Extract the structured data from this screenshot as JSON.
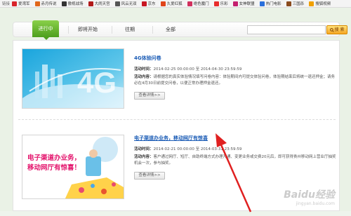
{
  "topbar": {
    "lead": "链接",
    "links": [
      {
        "label": "爱湾军",
        "color": "#d8232a"
      },
      {
        "label": "赤月传说",
        "color": "#e0671a"
      },
      {
        "label": "傲视战场",
        "color": "#333333"
      },
      {
        "label": "大闹天宫",
        "color": "#b11a1a"
      },
      {
        "label": "风云无双",
        "color": "#555555"
      },
      {
        "label": "京东",
        "color": "#c81623"
      },
      {
        "label": "久爱红狐",
        "color": "#e0441a"
      },
      {
        "label": "绝色魔门",
        "color": "#d1305d"
      },
      {
        "label": "乐彩",
        "color": "#e82c2c"
      },
      {
        "label": "女神联盟",
        "color": "#c41f6e"
      },
      {
        "label": "热门电影",
        "color": "#2a6fdb"
      },
      {
        "label": "三国杀",
        "color": "#8a4b1e"
      },
      {
        "label": "搜狐视频",
        "color": "#f0a000"
      }
    ]
  },
  "tabs": [
    "进行中",
    "即将开始",
    "往期",
    "全部"
  ],
  "search": {
    "placeholder": "",
    "button": "搜 索"
  },
  "cards": [
    {
      "title": "4G体验问卷",
      "time_label": "活动时间：",
      "time_value": "2014-02-25 00:00:00 至 2014-04-30 23:59:59",
      "content_label": "活动内容：",
      "content_value": "请根据您的真实体验情况填写问卷内容：体验期间内可提交体验问卷，体验期结束后将统一退还押金；请务必在4月30日前提交问卷，以便正常办理押金退还。",
      "button": "查看详情>>"
    },
    {
      "title": "电子渠道办业务，移动网厅有惊喜",
      "time_label": "活动时间：",
      "time_value": "2014-02-21 00:00:00 至 2014-03-31 23:59:59",
      "content_label": "活动内容：",
      "content_value": "客户通过网厅、短厅、自助终端方式办理开通、变更业务或交费20元后，即可获得贵州移动网上营业厅抽奖机会一次，参与抽奖。",
      "button": "查看详情>>"
    }
  ],
  "banner2": {
    "line1": "电子渠道办业务，",
    "line2": "移动网厅有惊喜！"
  },
  "banner1_text": "4G",
  "watermark": {
    "main": "Baidu经验",
    "sub": "jingyan.baidu.com"
  }
}
